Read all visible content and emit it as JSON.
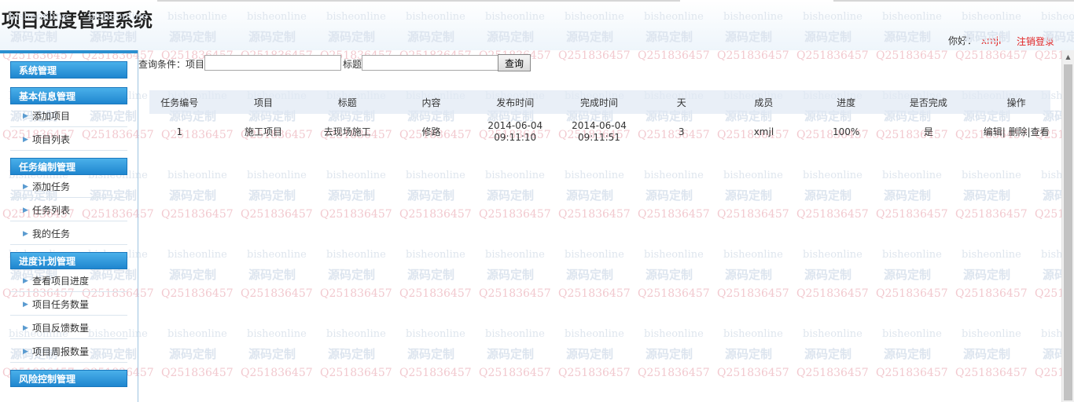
{
  "header": {
    "app_title": "项目进度管理系统",
    "greeting_label": "你好：",
    "username": "xmjl",
    "logout_label": "注销登录"
  },
  "watermark": {
    "en": "bisheonline",
    "cn": "源码定制",
    "qq": "Q2518364 57"
  },
  "sidebar": {
    "groups": [
      {
        "title": "系统管理",
        "items": []
      },
      {
        "title": "基本信息管理",
        "items": [
          {
            "label": "添加项目"
          },
          {
            "label": "项目列表"
          }
        ]
      },
      {
        "title": "任务编制管理",
        "items": [
          {
            "label": "添加任务"
          },
          {
            "label": "任务列表"
          },
          {
            "label": "我的任务"
          }
        ]
      },
      {
        "title": "进度计划管理",
        "items": [
          {
            "label": "查看项目进度"
          },
          {
            "label": "项目任务数量"
          },
          {
            "label": "项目反馈数量"
          },
          {
            "label": "项目周报数量"
          }
        ]
      },
      {
        "title": "风险控制管理",
        "items": []
      }
    ]
  },
  "query": {
    "label_prefix": "查询条件：项目",
    "project_value": "",
    "title_label": "标题",
    "title_value": "",
    "search_button": "查询"
  },
  "table": {
    "columns": [
      "任务编号",
      "项目",
      "标题",
      "内容",
      "发布时间",
      "完成时间",
      "天",
      "成员",
      "进度",
      "是否完成",
      "操作"
    ],
    "rows": [
      {
        "id": "1",
        "project": "施工项目",
        "title": "去现场施工",
        "content": "修路",
        "publish_date": "2014-06-04",
        "publish_time": "09:11:10",
        "finish_date": "2014-06-04",
        "finish_time": "09:11:51",
        "days": "3",
        "member": "xmjl",
        "progress": "100%",
        "completed": "是",
        "op_edit": "编辑|",
        "op_delete": "删除|",
        "op_view": "查看"
      }
    ]
  },
  "colors": {
    "accent_blue": "#1f86cf",
    "username_red": "#e02020"
  }
}
